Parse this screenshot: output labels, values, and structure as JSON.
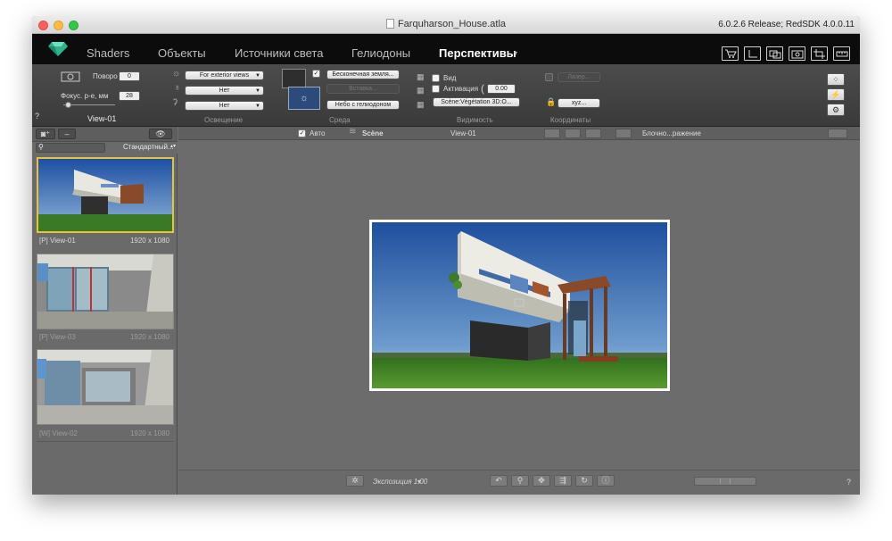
{
  "window": {
    "document_title": "Farquharson_House.atla",
    "version": "6.0.2.6 Release; RedSDK 4.0.0.11"
  },
  "tabs": [
    {
      "label": "Shaders",
      "active": false
    },
    {
      "label": "Объекты",
      "active": false
    },
    {
      "label": "Источники света",
      "active": false
    },
    {
      "label": "Гелиодоны",
      "active": false
    },
    {
      "label": "Перспективы",
      "active": true
    }
  ],
  "tab_caret": "▾",
  "toolbar_icons": [
    "cart-icon",
    "corner-icon",
    "views-icon",
    "camera-icon",
    "crop-icon",
    "ruler-icon"
  ],
  "toolbar": {
    "rotation_label": "Поворо",
    "rotation_value": "0",
    "focal_label": "Фокус. р-е, мм",
    "focal_value": "28",
    "view_name": "View-01",
    "help": "?",
    "lighting": {
      "preset": "For exterior views",
      "dd2": "Нет",
      "dd3": "Нет",
      "section_label": "Освещение"
    },
    "environment": {
      "ground": "Бесконечная земля...",
      "insert": "Вставка...",
      "sky": "Небо с гелиодоном",
      "section_label": "Среда"
    },
    "visibility": {
      "view_label": "Вид",
      "activation_label": "Активация",
      "activation_value": "0.00",
      "scene_dd": "Scène:Végétation 3D:O...",
      "section_label": "Видимость"
    },
    "coordinates": {
      "laser": "Лазер...",
      "xyz": "xyz...",
      "section_label": "Координаты"
    }
  },
  "left_panel": {
    "search_placeholder": "",
    "sort_option": "Стандартный...",
    "thumbnails": [
      {
        "caption": "[P] View-01",
        "resolution": "1920 x 1080",
        "active": true
      },
      {
        "caption": "[P] View-03",
        "resolution": "1920 x 1080",
        "active": false
      },
      {
        "caption": "[W] View-02",
        "resolution": "1920 x 1080",
        "active": false
      }
    ]
  },
  "viewbar": {
    "auto_label": "Авто",
    "scene_label": "Scène",
    "view_name": "View-01",
    "block_label": "Блочно...ражение"
  },
  "bottombar": {
    "exposure_label": "Экспозиция 1.00",
    "exposure_caret": "▾",
    "help": "?"
  },
  "colors": {
    "active_thumb_border": "#e6c33b",
    "tabbar_bg": "#0c0c0c",
    "workspace_bg": "#6c6c6c",
    "logo_green": "#2fb38a"
  }
}
